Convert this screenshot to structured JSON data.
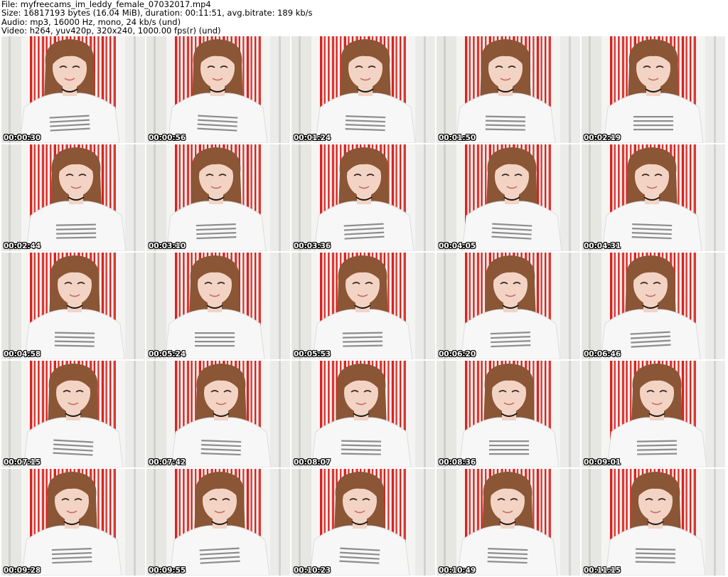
{
  "header": {
    "file": "File: myfreecams_im_leddy_female_07032017.mp4",
    "size": "Size: 16817193 bytes (16.04 MiB), duration: 00:11:51, avg.bitrate: 189 kb/s",
    "audio": "Audio: mp3, 16000 Hz, mono, 24 kb/s (und)",
    "video": "Video: h264, yuv420p, 320x240, 1000.00 fps(r) (und)"
  },
  "colors": {
    "background": "#ffffff",
    "curtain_red": "#d9231f",
    "wall": "#f4f4f2",
    "hair": "#8a5636",
    "skin": "#f3d4c4",
    "shirt": "#f7f7f7",
    "timestamp": "#ffffff"
  },
  "thumbnails": [
    {
      "time": "00:00:30"
    },
    {
      "time": "00:00:56"
    },
    {
      "time": "00:01:24"
    },
    {
      "time": "00:01:50"
    },
    {
      "time": "00:02:19"
    },
    {
      "time": "00:02:44"
    },
    {
      "time": "00:03:10"
    },
    {
      "time": "00:03:36"
    },
    {
      "time": "00:04:05"
    },
    {
      "time": "00:04:31"
    },
    {
      "time": "00:04:58"
    },
    {
      "time": "00:05:24"
    },
    {
      "time": "00:05:53"
    },
    {
      "time": "00:06:20"
    },
    {
      "time": "00:06:46"
    },
    {
      "time": "00:07:15"
    },
    {
      "time": "00:07:42"
    },
    {
      "time": "00:08:07"
    },
    {
      "time": "00:08:36"
    },
    {
      "time": "00:09:01"
    },
    {
      "time": "00:09:28"
    },
    {
      "time": "00:09:55"
    },
    {
      "time": "00:10:23"
    },
    {
      "time": "00:10:49"
    },
    {
      "time": "00:11:15"
    }
  ]
}
